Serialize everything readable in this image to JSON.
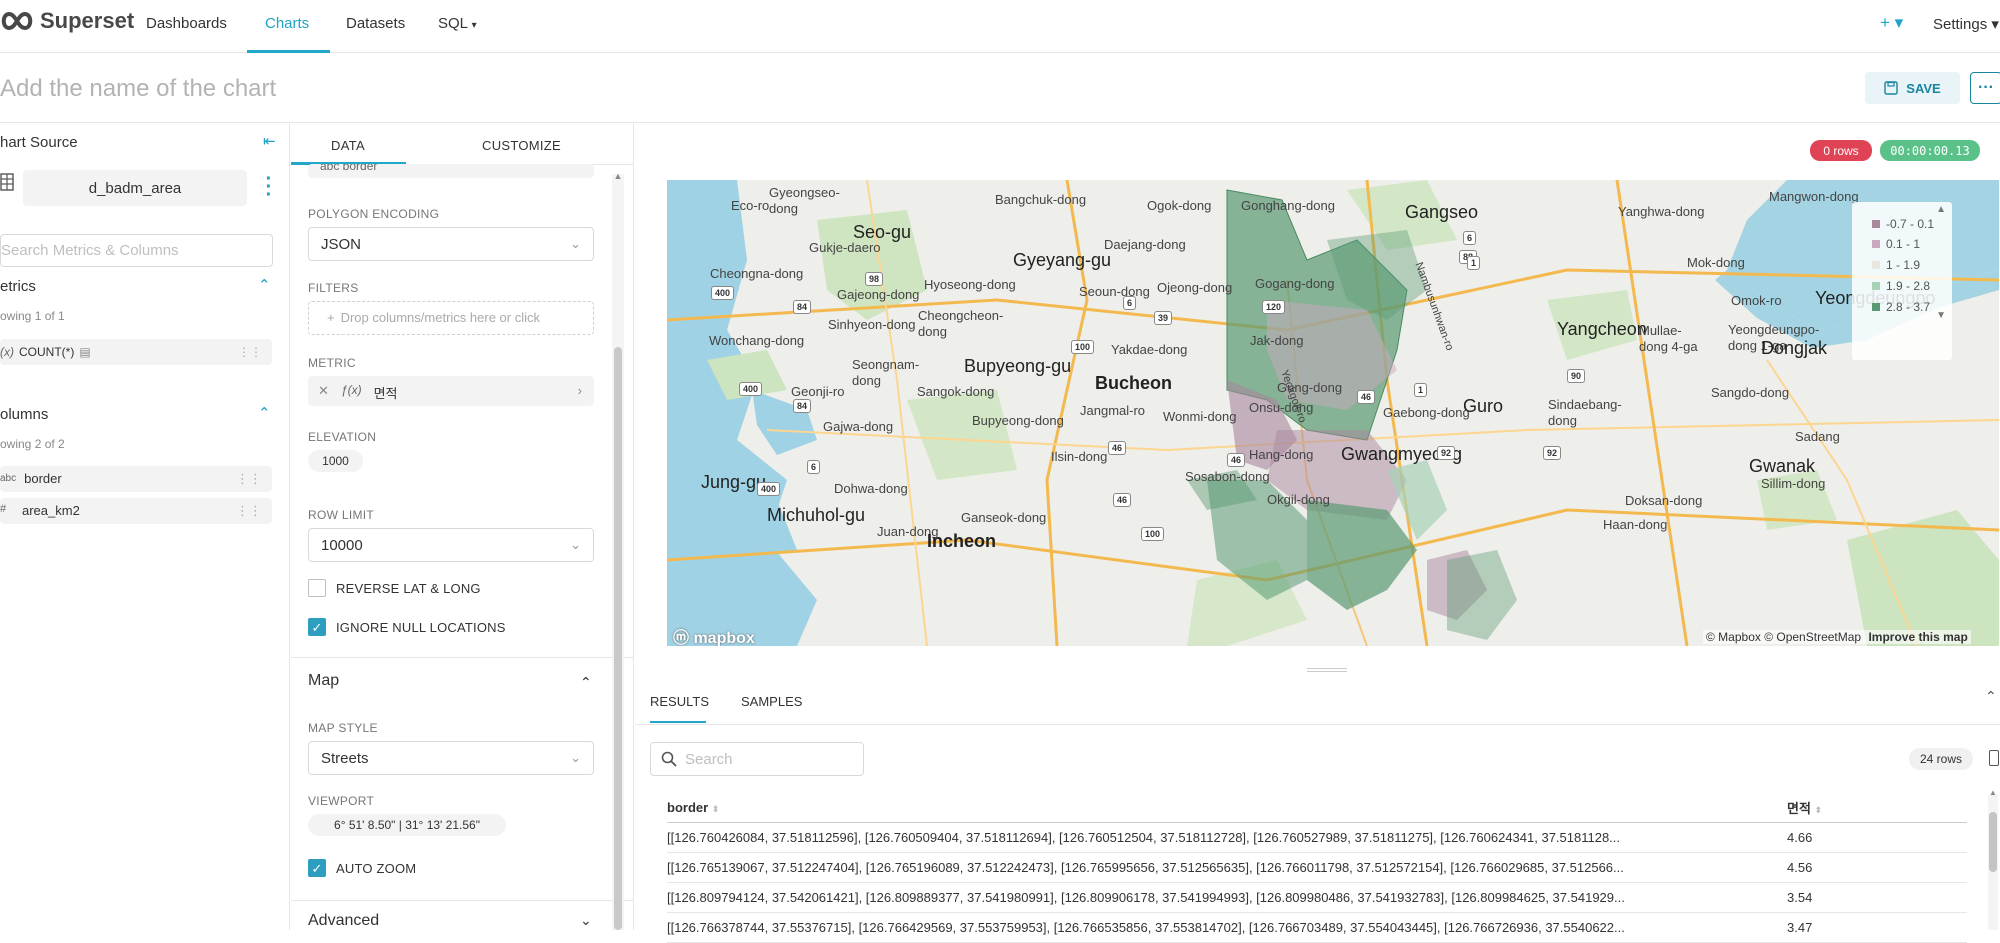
{
  "nav": {
    "brand": "Superset",
    "links": [
      "Dashboards",
      "Charts",
      "Datasets",
      "SQL"
    ],
    "sql_caret": "▾",
    "plus": "+ ▾",
    "settings": "Settings ▾"
  },
  "title": {
    "placeholder": "Add the name of the chart",
    "save": "SAVE",
    "more": "···"
  },
  "source": {
    "header": "hart Source",
    "dataset": "d_badm_area",
    "search_placeholder": "Search Metrics & Columns",
    "metrics_header": "etrics",
    "metrics_count": "owing 1 of 1",
    "metric_item": "COUNT(*)",
    "metric_prefix": "(x)",
    "columns_header": "olumns",
    "columns_count": "owing 2 of 2",
    "columns": [
      {
        "type": "abc",
        "name": "border"
      },
      {
        "type": "#",
        "name": "area_km2"
      }
    ]
  },
  "controls": {
    "tabs": [
      "DATA",
      "CUSTOMIZE"
    ],
    "top_chip": "abc  border",
    "polygon_encoding_label": "POLYGON ENCODING",
    "polygon_encoding_value": "JSON",
    "filters_label": "FILTERS",
    "filters_placeholder": "Drop columns/metrics here or click",
    "metric_label": "METRIC",
    "metric_value": "면적",
    "elevation_label": "ELEVATION",
    "elevation_value": "1000",
    "row_limit_label": "ROW LIMIT",
    "row_limit_value": "10000",
    "reverse_label": "REVERSE LAT & LONG",
    "ignore_null_label": "IGNORE NULL LOCATIONS",
    "map_section": "Map",
    "map_style_label": "MAP STYLE",
    "map_style_value": "Streets",
    "viewport_label": "VIEWPORT",
    "viewport_value": "6° 51' 8.50\" | 31° 13' 21.56\"",
    "auto_zoom_label": "AUTO ZOOM",
    "advanced_section": "Advanced"
  },
  "status": {
    "rows": "0 rows",
    "timer": "00:00:00.13"
  },
  "map": {
    "legend": [
      {
        "label": "-0.7 - 0.1",
        "color": "#a9879d"
      },
      {
        "label": "0.1 - 1",
        "color": "#c9a9be"
      },
      {
        "label": "1 - 1.9",
        "color": "#e8e8e0"
      },
      {
        "label": "1.9 - 2.8",
        "color": "#a6d2b6"
      },
      {
        "label": "2.8 - 3.7",
        "color": "#5a9a72"
      }
    ],
    "labels": [
      {
        "text": "Gyeongseo-\ndong"
      },
      {
        "text": "Bangchuk-dong"
      },
      {
        "text": "Ogok-dong"
      },
      {
        "text": "Gonghang-dong"
      },
      {
        "text": "Gangseo"
      },
      {
        "text": "Yanghwa-dong"
      },
      {
        "text": "Mangwon-dong"
      },
      {
        "text": "Seo-gu"
      },
      {
        "text": "Gukje-daero"
      },
      {
        "text": "Gyeyang-gu"
      },
      {
        "text": "Daejang-dong"
      },
      {
        "text": "Cheongna-dong"
      },
      {
        "text": "Hyoseong-dong"
      },
      {
        "text": "Gajeong-dong"
      },
      {
        "text": "Seoun-dong"
      },
      {
        "text": "Ojeong-dong"
      },
      {
        "text": "Gogang-dong"
      },
      {
        "text": "Mok-dong"
      },
      {
        "text": "Omok-ro"
      },
      {
        "text": "Yeongdeungpo"
      },
      {
        "text": "Sinhyeon-dong"
      },
      {
        "text": "Cheongcheon-\ndong"
      },
      {
        "text": "Wonchang-dong"
      },
      {
        "text": "Yakdae-dong"
      },
      {
        "text": "Jak-dong"
      },
      {
        "text": "Yangcheon"
      },
      {
        "text": "Mullae-\ndong 4-ga"
      },
      {
        "text": "Yeongdeungpo-\ndong 1-ga"
      },
      {
        "text": "Dongjak"
      },
      {
        "text": "Seongnam-\ndong"
      },
      {
        "text": "Bupyeong-gu"
      },
      {
        "text": "Geonji-ro"
      },
      {
        "text": "Sangok-dong"
      },
      {
        "text": "Bucheon"
      },
      {
        "text": "Gung-dong"
      },
      {
        "text": "Guro"
      },
      {
        "text": "Sindaebang-\ndong"
      },
      {
        "text": "Sangdo-dong"
      },
      {
        "text": "Jangmal-ro"
      },
      {
        "text": "Wonmi-dong"
      },
      {
        "text": "Onsu-dong"
      },
      {
        "text": "Gaebong-dong"
      },
      {
        "text": "Gajwa-dong"
      },
      {
        "text": "Bupyeong-dong"
      },
      {
        "text": "Ilsin-dong"
      },
      {
        "text": "Hang-dong"
      },
      {
        "text": "Gwangmyeong"
      },
      {
        "text": "Sadang"
      },
      {
        "text": "Sosabon-dong"
      },
      {
        "text": "Gwanak"
      },
      {
        "text": "Jung-gu"
      },
      {
        "text": "Dohwa-dong"
      },
      {
        "text": "Sillim-dong"
      },
      {
        "text": "Okgil-dong"
      },
      {
        "text": "Doksan-dong"
      },
      {
        "text": "Michuhol-gu"
      },
      {
        "text": "Ganseok-dong"
      },
      {
        "text": "Haan-dong"
      },
      {
        "text": "Juan-dong"
      },
      {
        "text": "Incheon"
      },
      {
        "text": "Nambusunhwan-ro"
      },
      {
        "text": "Yeokgok-ro"
      },
      {
        "text": "Eco-ro"
      }
    ],
    "road_markers": [
      "39",
      "6",
      "88",
      "1",
      "98",
      "400",
      "84",
      "6",
      "39",
      "120",
      "90",
      "400",
      "84",
      "100",
      "46",
      "1",
      "92",
      "92",
      "46",
      "46",
      "46",
      "100",
      "6",
      "400",
      "100"
    ],
    "attribution": "© Mapbox © OpenStreetMap",
    "improve": "Improve this map",
    "watermark": "mapbox"
  },
  "results": {
    "tabs": [
      "RESULTS",
      "SAMPLES"
    ],
    "search_placeholder": "Search",
    "row_count": "24 rows",
    "columns": [
      "border",
      "면적"
    ],
    "rows": [
      [
        "[[126.760426084, 37.518112596], [126.760509404, 37.518112694], [126.760512504, 37.518112728], [126.760527989, 37.51811275], [126.760624341, 37.5181128...",
        "4.66"
      ],
      [
        "[[126.765139067, 37.512247404], [126.765196089, 37.512242473], [126.765995656, 37.512565635], [126.766011798, 37.512572154], [126.766029685, 37.512566...",
        "4.56"
      ],
      [
        "[[126.809794124, 37.542061421], [126.809889377, 37.541980991], [126.809906178, 37.541994993], [126.809980486, 37.541932783], [126.809984625, 37.541929...",
        "3.54"
      ],
      [
        "[[126.766378744, 37.55376715], [126.766429569, 37.553759953], [126.766535856, 37.553814702], [126.766703489, 37.554043445], [126.766726936, 37.5540622...",
        "3.47"
      ]
    ]
  }
}
